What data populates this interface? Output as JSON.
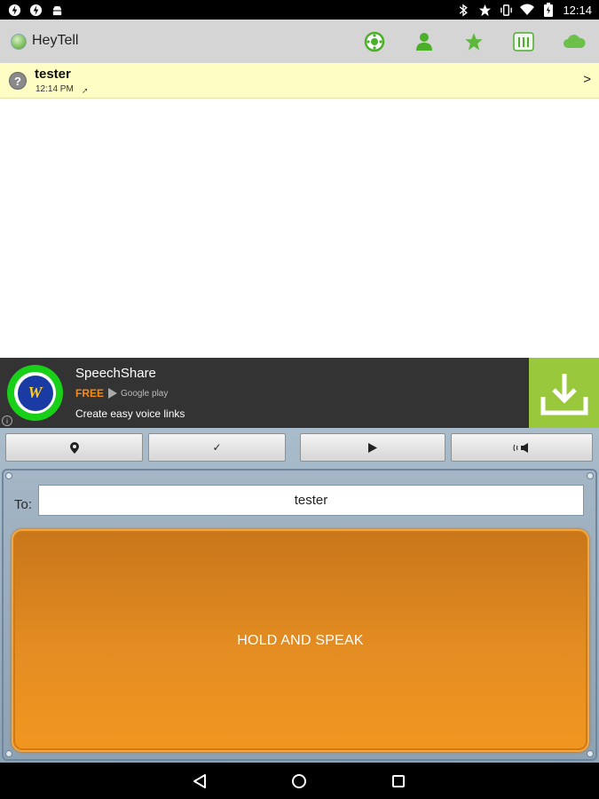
{
  "status_bar": {
    "time": "12:14",
    "left_icons": [
      "flash-notification-icon",
      "flash-notification-icon",
      "android-debug-icon"
    ],
    "right_icons": [
      "bluetooth-icon",
      "star-icon",
      "vibrate-icon",
      "wifi-icon",
      "battery-icon"
    ]
  },
  "action_bar": {
    "app_title": "HeyTell",
    "actions": [
      "settings-gear-icon",
      "contacts-icon",
      "favorite-star-icon",
      "groups-icon",
      "cloud-icon"
    ]
  },
  "conversation": {
    "name": "tester",
    "time": "12:14 PM",
    "status_icon": "?",
    "sent_icon": "➚",
    "chevron": ">"
  },
  "ad": {
    "title": "SpeechShare",
    "free_label": "FREE",
    "store_label": "Google play",
    "description": "Create easy voice links",
    "info_label": "i",
    "logo_text": "W"
  },
  "toolbar": {
    "location_icon": "location-pin-icon",
    "check_label": "✓",
    "play_icon": "play-icon",
    "speaker_icon": "speaker-icon"
  },
  "recorder": {
    "to_label": "To:",
    "recipient": "tester",
    "hold_label": "HOLD AND SPEAK"
  },
  "colors": {
    "action_bar": "#d5d5d5",
    "conversation_highlight": "#fdfdc4",
    "ad_background": "#333333",
    "ad_download": "#9ac83c",
    "speak_button": "#e48d22",
    "panel": "#9fb3c4"
  }
}
